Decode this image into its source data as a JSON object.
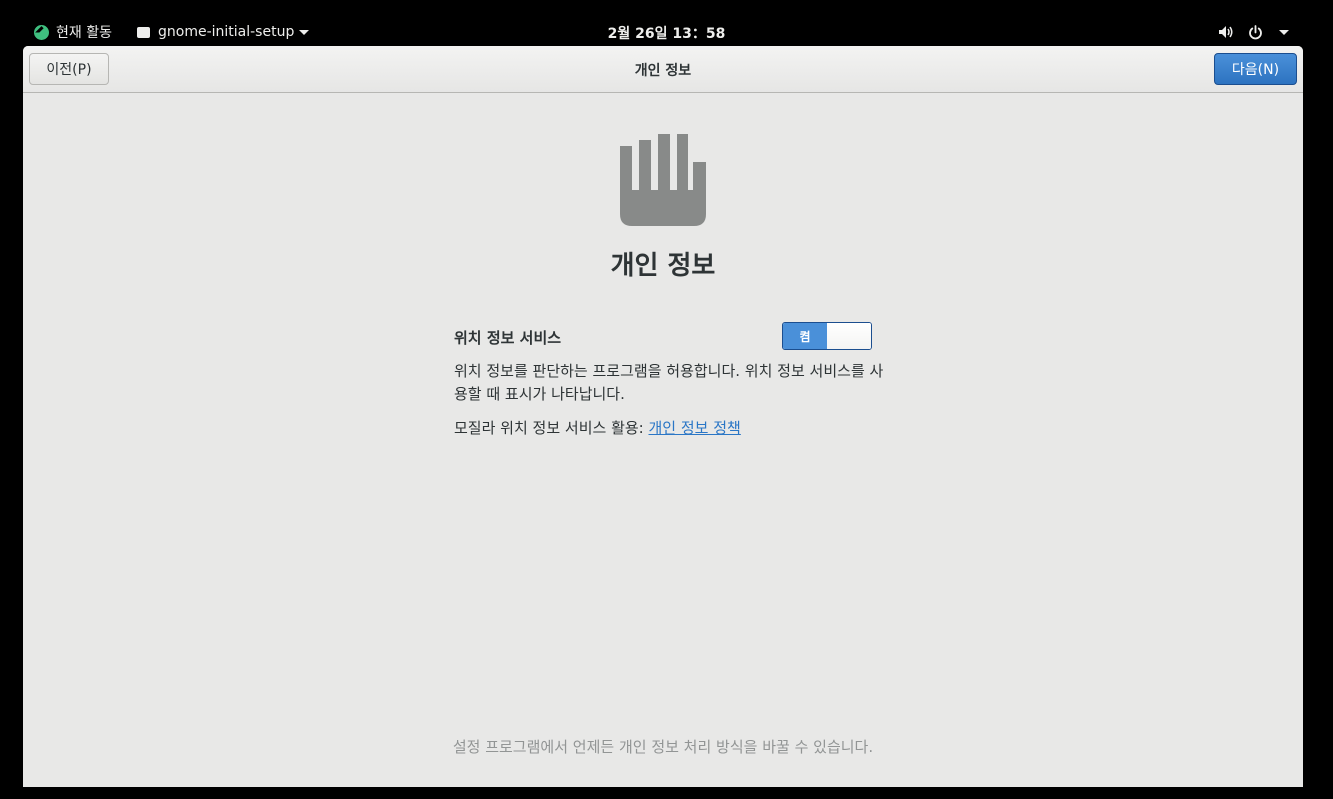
{
  "topbar": {
    "activities_label": "현재 활동",
    "app_name": "gnome-initial-setup",
    "clock": "2월 26일  13：58",
    "icons": [
      "volume-icon",
      "power-icon",
      "chevron-down-icon"
    ]
  },
  "window": {
    "title": "개인 정보",
    "prev_button": "이전(P)",
    "next_button": "다음(N)"
  },
  "page": {
    "icon": "hand-stop-icon",
    "heading": "개인 정보",
    "location": {
      "label": "위치 정보 서비스",
      "switch_on_label": "켬",
      "switch_state": true,
      "description": "위치 정보를 판단하는 프로그램을 허용합니다. 위치 정보 서비스를 사용할 때 표시가 나타납니다.",
      "mozilla_prefix": "모질라 위치 정보 서비스 활용: ",
      "privacy_link": "개인 정보 정책"
    },
    "footer_note": "설정 프로그램에서 언제든 개인 정보 처리 방식을 바꿀 수 있습니다."
  },
  "colors": {
    "accent": "#4a90d9",
    "window_bg": "#e8e8e7",
    "link": "#2a76c6",
    "icon_gray": "#888a89"
  }
}
